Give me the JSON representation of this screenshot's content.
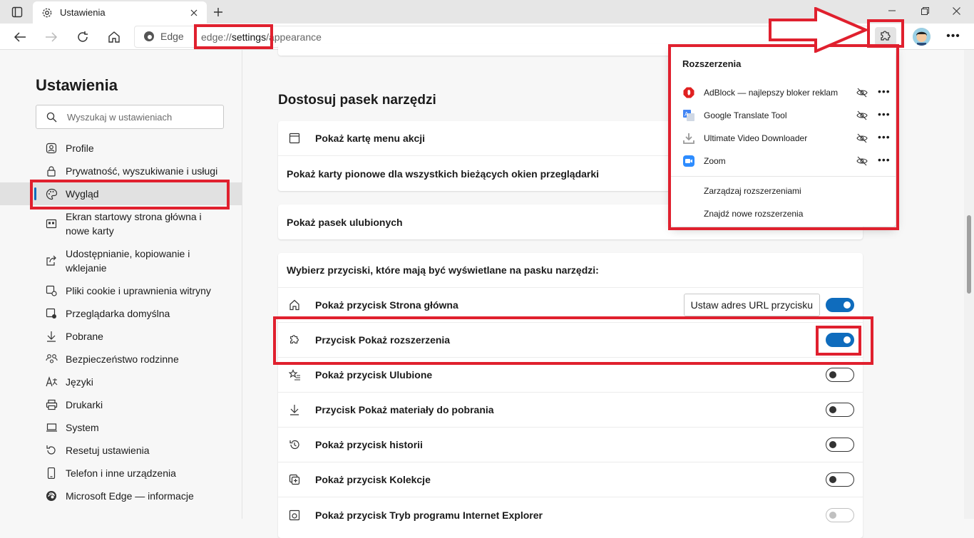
{
  "browser": {
    "tab_title": "Ustawienia",
    "edge_label": "Edge",
    "url_prefix": "edge://",
    "url_highlight": "settings",
    "url_suffix": "/appearance"
  },
  "sidebar": {
    "title": "Ustawienia",
    "search_placeholder": "Wyszukaj w ustawieniach",
    "items": [
      {
        "label": "Profile",
        "icon": "profile-icon"
      },
      {
        "label": "Prywatność, wyszukiwanie i usługi",
        "icon": "lock-icon"
      },
      {
        "label": "Wygląd",
        "icon": "palette-icon",
        "active": true
      },
      {
        "label": "Ekran startowy strona główna i nowe karty",
        "icon": "start-page-icon"
      },
      {
        "label": "Udostępnianie, kopiowanie i wklejanie",
        "icon": "share-icon"
      },
      {
        "label": "Pliki cookie i uprawnienia witryny",
        "icon": "cookie-icon"
      },
      {
        "label": "Przeglądarka domyślna",
        "icon": "default-browser-icon"
      },
      {
        "label": "Pobrane",
        "icon": "download-icon"
      },
      {
        "label": "Bezpieczeństwo rodzinne",
        "icon": "family-icon"
      },
      {
        "label": "Języki",
        "icon": "language-icon"
      },
      {
        "label": "Drukarki",
        "icon": "printer-icon"
      },
      {
        "label": "System",
        "icon": "system-icon"
      },
      {
        "label": "Resetuj ustawienia",
        "icon": "reset-icon"
      },
      {
        "label": "Telefon i inne urządzenia",
        "icon": "phone-icon"
      },
      {
        "label": "Microsoft Edge — informacje",
        "icon": "edge-icon"
      }
    ]
  },
  "main": {
    "section_title": "Dostosuj pasek narzędzi",
    "card1": {
      "row1": "Pokaż kartę menu akcji",
      "row2": "Pokaż karty pionowe dla wszystkich bieżących okien przeglądarki"
    },
    "card2": {
      "row1": "Pokaż pasek ulubionych"
    },
    "card3": {
      "header": "Wybierz przyciski, które mają być wyświetlane na pasku narzędzi:",
      "url_button": "Ustaw adres URL przycisku",
      "rows": [
        {
          "label": "Pokaż przycisk Strona główna",
          "on": true
        },
        {
          "label": "Przycisk Pokaż rozszerzenia",
          "on": true
        },
        {
          "label": "Pokaż przycisk Ulubione",
          "on": false
        },
        {
          "label": "Przycisk Pokaż materiały do pobrania",
          "on": false
        },
        {
          "label": "Pokaż przycisk historii",
          "on": false
        },
        {
          "label": "Pokaż przycisk Kolekcje",
          "on": false
        },
        {
          "label": "Pokaż przycisk Tryb programu Internet Explorer",
          "on": false
        }
      ]
    }
  },
  "extensions_panel": {
    "title": "Rozszerzenia",
    "items": [
      {
        "label": "AdBlock — najlepszy bloker reklam",
        "icon": "adblock-icon"
      },
      {
        "label": "Google Translate Tool",
        "icon": "translate-icon"
      },
      {
        "label": "Ultimate Video Downloader",
        "icon": "video-download-icon"
      },
      {
        "label": "Zoom",
        "icon": "zoom-icon"
      }
    ],
    "manage": "Zarządzaj rozszerzeniami",
    "find": "Znajdź nowe rozszerzenia"
  },
  "colors": {
    "accent": "#0f6cbd",
    "highlight": "#e0202e"
  }
}
